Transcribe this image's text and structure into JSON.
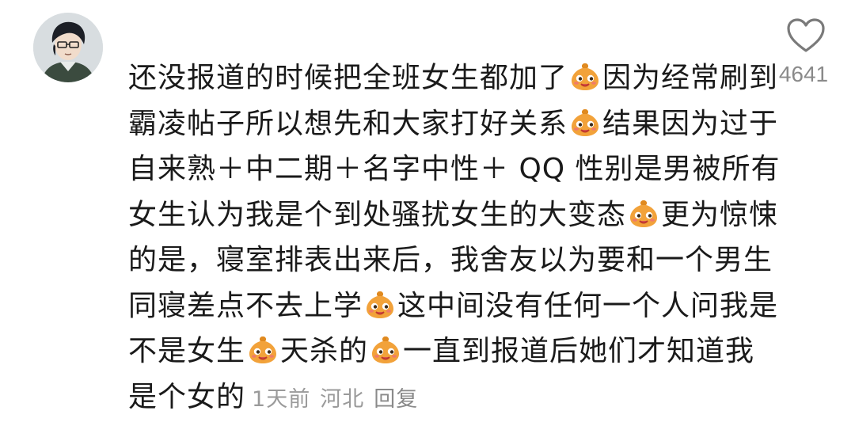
{
  "comment": {
    "lines": [
      [
        "还没报道的时候把全班女生都加了",
        "emoji",
        "因为经常刷到"
      ],
      [
        "霸凌帖子所以想先和大家打好关系",
        "emoji",
        "结果因为过于"
      ],
      [
        "自来熟＋中二期＋名字中性＋ QQ 性别是男被所有"
      ],
      [
        "女生认为我是个到处骚扰女生的大变态",
        "emoji",
        "更为惊悚"
      ],
      [
        "的是，寝室排表出来后，我舍友以为要和一个男生"
      ],
      [
        "同寝差点不去上学",
        "emoji",
        "这中间没有任何一个人问我是"
      ],
      [
        "不是女生",
        "emoji",
        "天杀的",
        "emoji",
        "一直到报道后她们才知道我"
      ],
      [
        "是个女的"
      ]
    ],
    "time": "1天前",
    "location": "河北",
    "reply_label": "回复"
  },
  "likes": {
    "count": "4641",
    "icon": "heart-outline-icon"
  },
  "avatar": {
    "icon": "user-avatar"
  },
  "emoji": {
    "icon": "smirk-emoji-icon",
    "color": "#f2a23a"
  }
}
